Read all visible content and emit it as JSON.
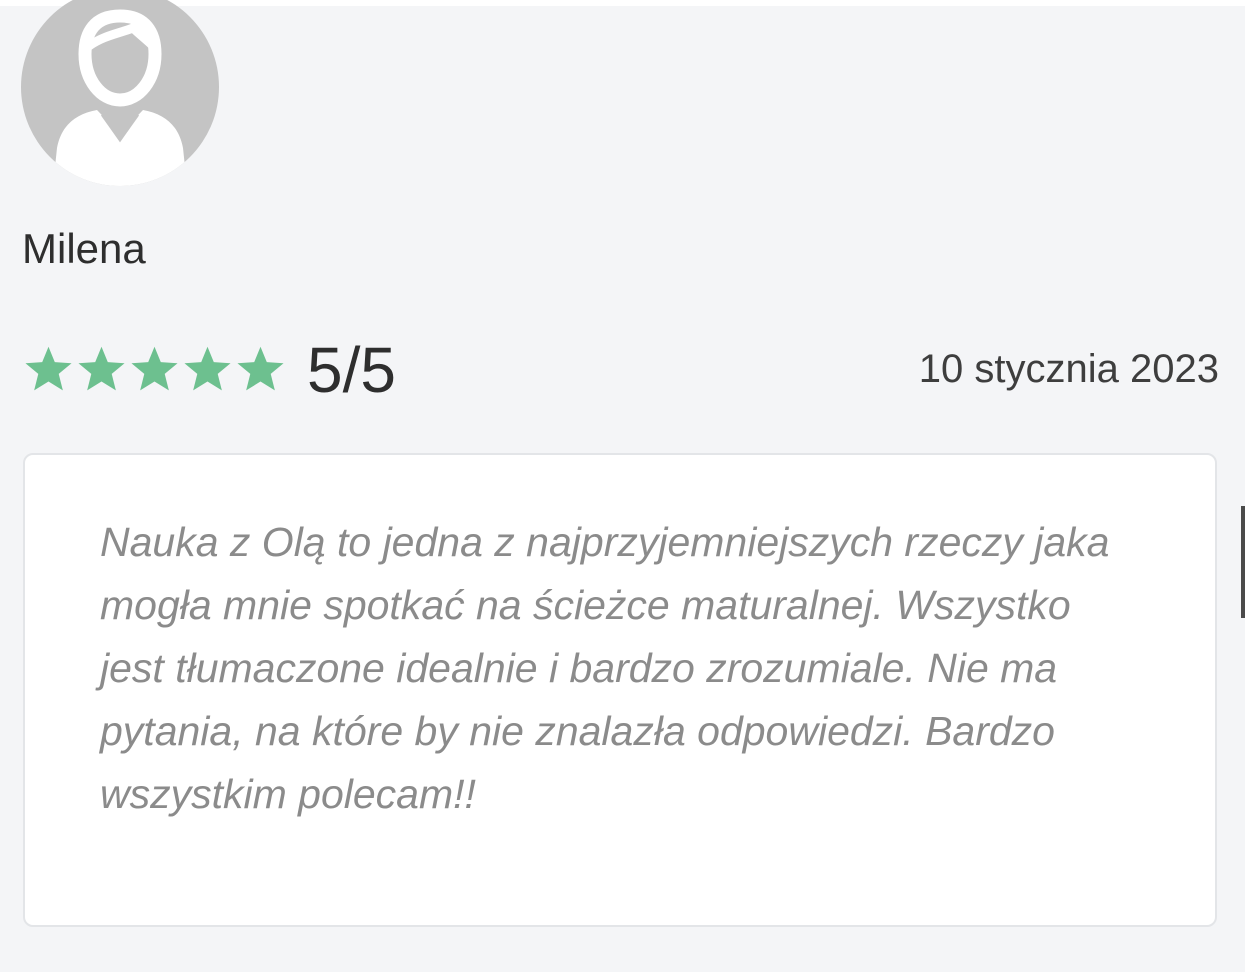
{
  "review": {
    "avatar_icon": "user-silhouette-icon",
    "reviewer_name": "Milena",
    "rating": {
      "stars_filled": 5,
      "stars_total": 5,
      "star_icon": "star-icon",
      "star_color": "#6dc08f",
      "label": "5/5"
    },
    "date": "10 stycznia 2023",
    "body": "Nauka z Olą to jedna z najprzyjemniejszych rzeczy jaka mogła mnie spotkać na ścieżce maturalnej. Wszystko jest tłumaczone idealnie i bardzo zrozumiale. Nie ma pytania, na które by nie znalazła odpowiedzi. Bardzo wszystkim polecam!!"
  }
}
